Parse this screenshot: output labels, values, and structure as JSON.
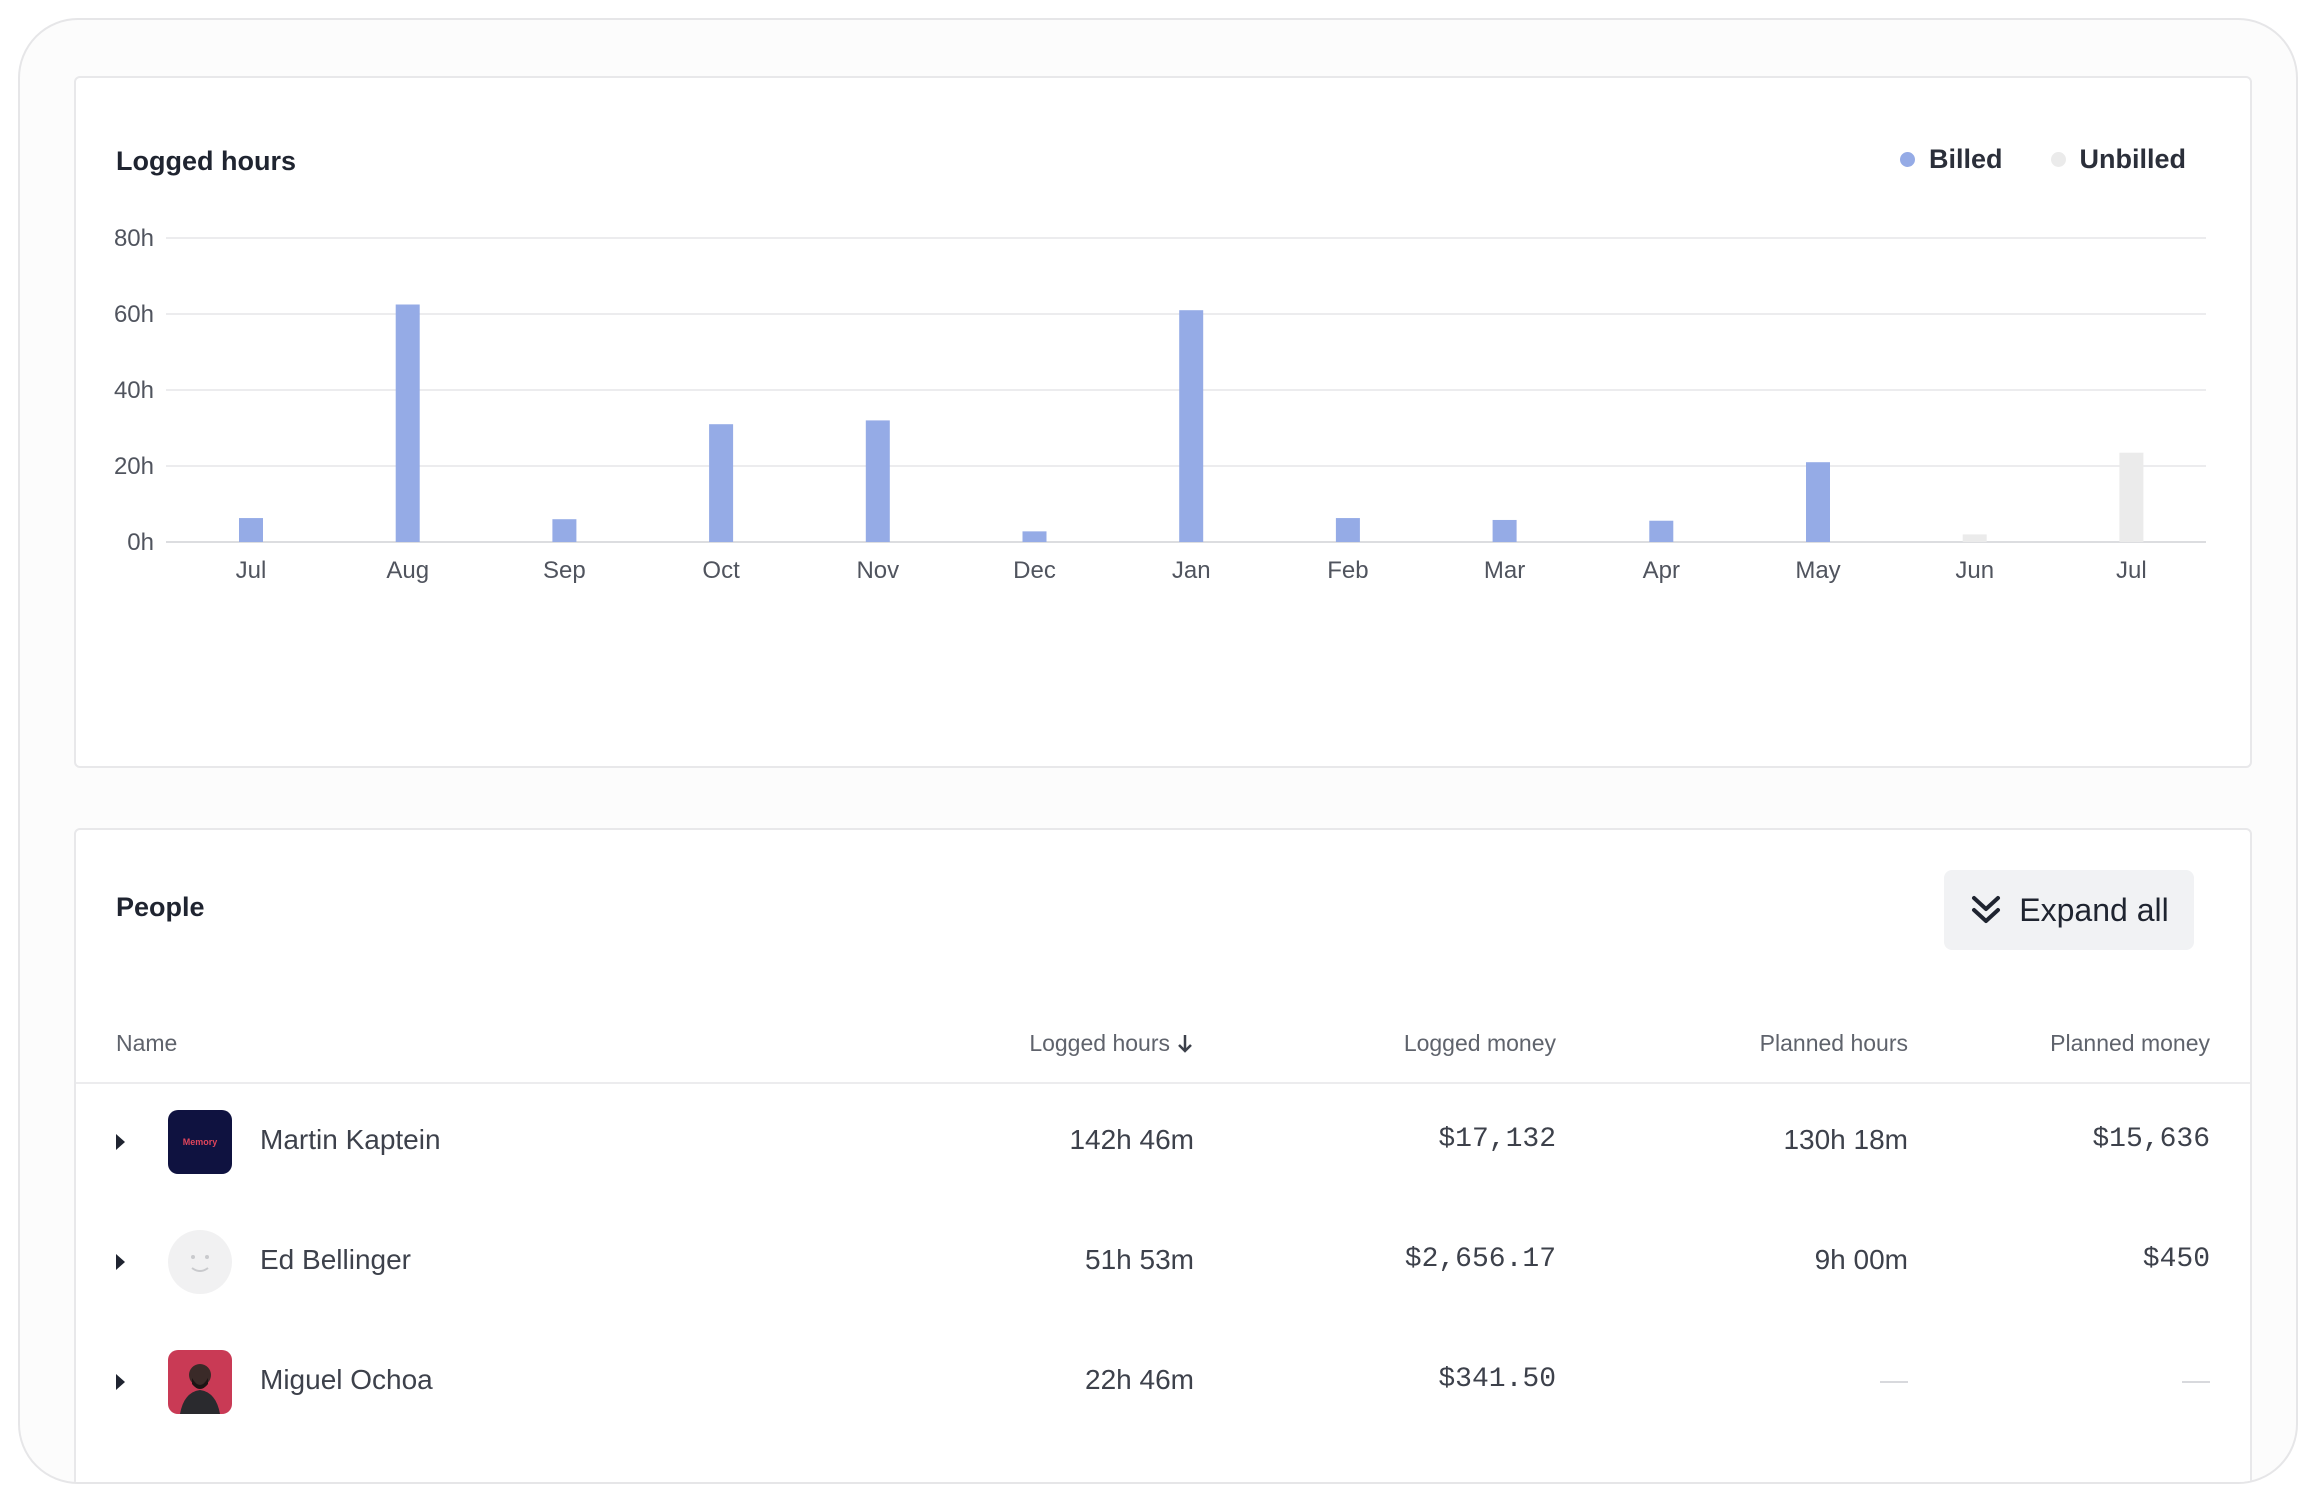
{
  "chart_panel": {
    "title": "Logged hours",
    "legend": [
      {
        "label": "Billed",
        "color": "#95abe6"
      },
      {
        "label": "Unbilled",
        "color": "#ebebeb"
      }
    ]
  },
  "chart_data": {
    "type": "bar",
    "categories": [
      "Jul",
      "Aug",
      "Sep",
      "Oct",
      "Nov",
      "Dec",
      "Jan",
      "Feb",
      "Mar",
      "Apr",
      "May",
      "Jun",
      "Jul"
    ],
    "series": [
      {
        "name": "Billed",
        "color": "#95abe6",
        "values": [
          6.3,
          62.5,
          6,
          31,
          32,
          2.8,
          61,
          6.3,
          5.8,
          5.6,
          21,
          0,
          0
        ]
      },
      {
        "name": "Unbilled",
        "color": "#ebebeb",
        "values": [
          0,
          0,
          0,
          0,
          0,
          0,
          0,
          0,
          0,
          0,
          0,
          2,
          23.5
        ]
      }
    ],
    "yticks": [
      "0h",
      "20h",
      "40h",
      "60h",
      "80h"
    ],
    "ylim": [
      0,
      80
    ],
    "grid": true,
    "legend_position": "top-right"
  },
  "people_panel": {
    "title": "People",
    "expand_label": "Expand all",
    "columns": {
      "name": "Name",
      "logged_hours": "Logged hours",
      "logged_money": "Logged money",
      "planned_hours": "Planned hours",
      "planned_money": "Planned money"
    },
    "rows": [
      {
        "name": "Martin Kaptein",
        "logged_hours": "142h 46m",
        "logged_money": "$17,132",
        "planned_hours": "130h 18m",
        "planned_money": "$15,636",
        "avatar_text": "Memory"
      },
      {
        "name": "Ed Bellinger",
        "logged_hours": "51h 53m",
        "logged_money": "$2,656.17",
        "planned_hours": "9h 00m",
        "planned_money": "$450"
      },
      {
        "name": "Miguel Ochoa",
        "logged_hours": "22h 46m",
        "logged_money": "$341.50",
        "planned_hours": "",
        "planned_money": ""
      }
    ]
  }
}
